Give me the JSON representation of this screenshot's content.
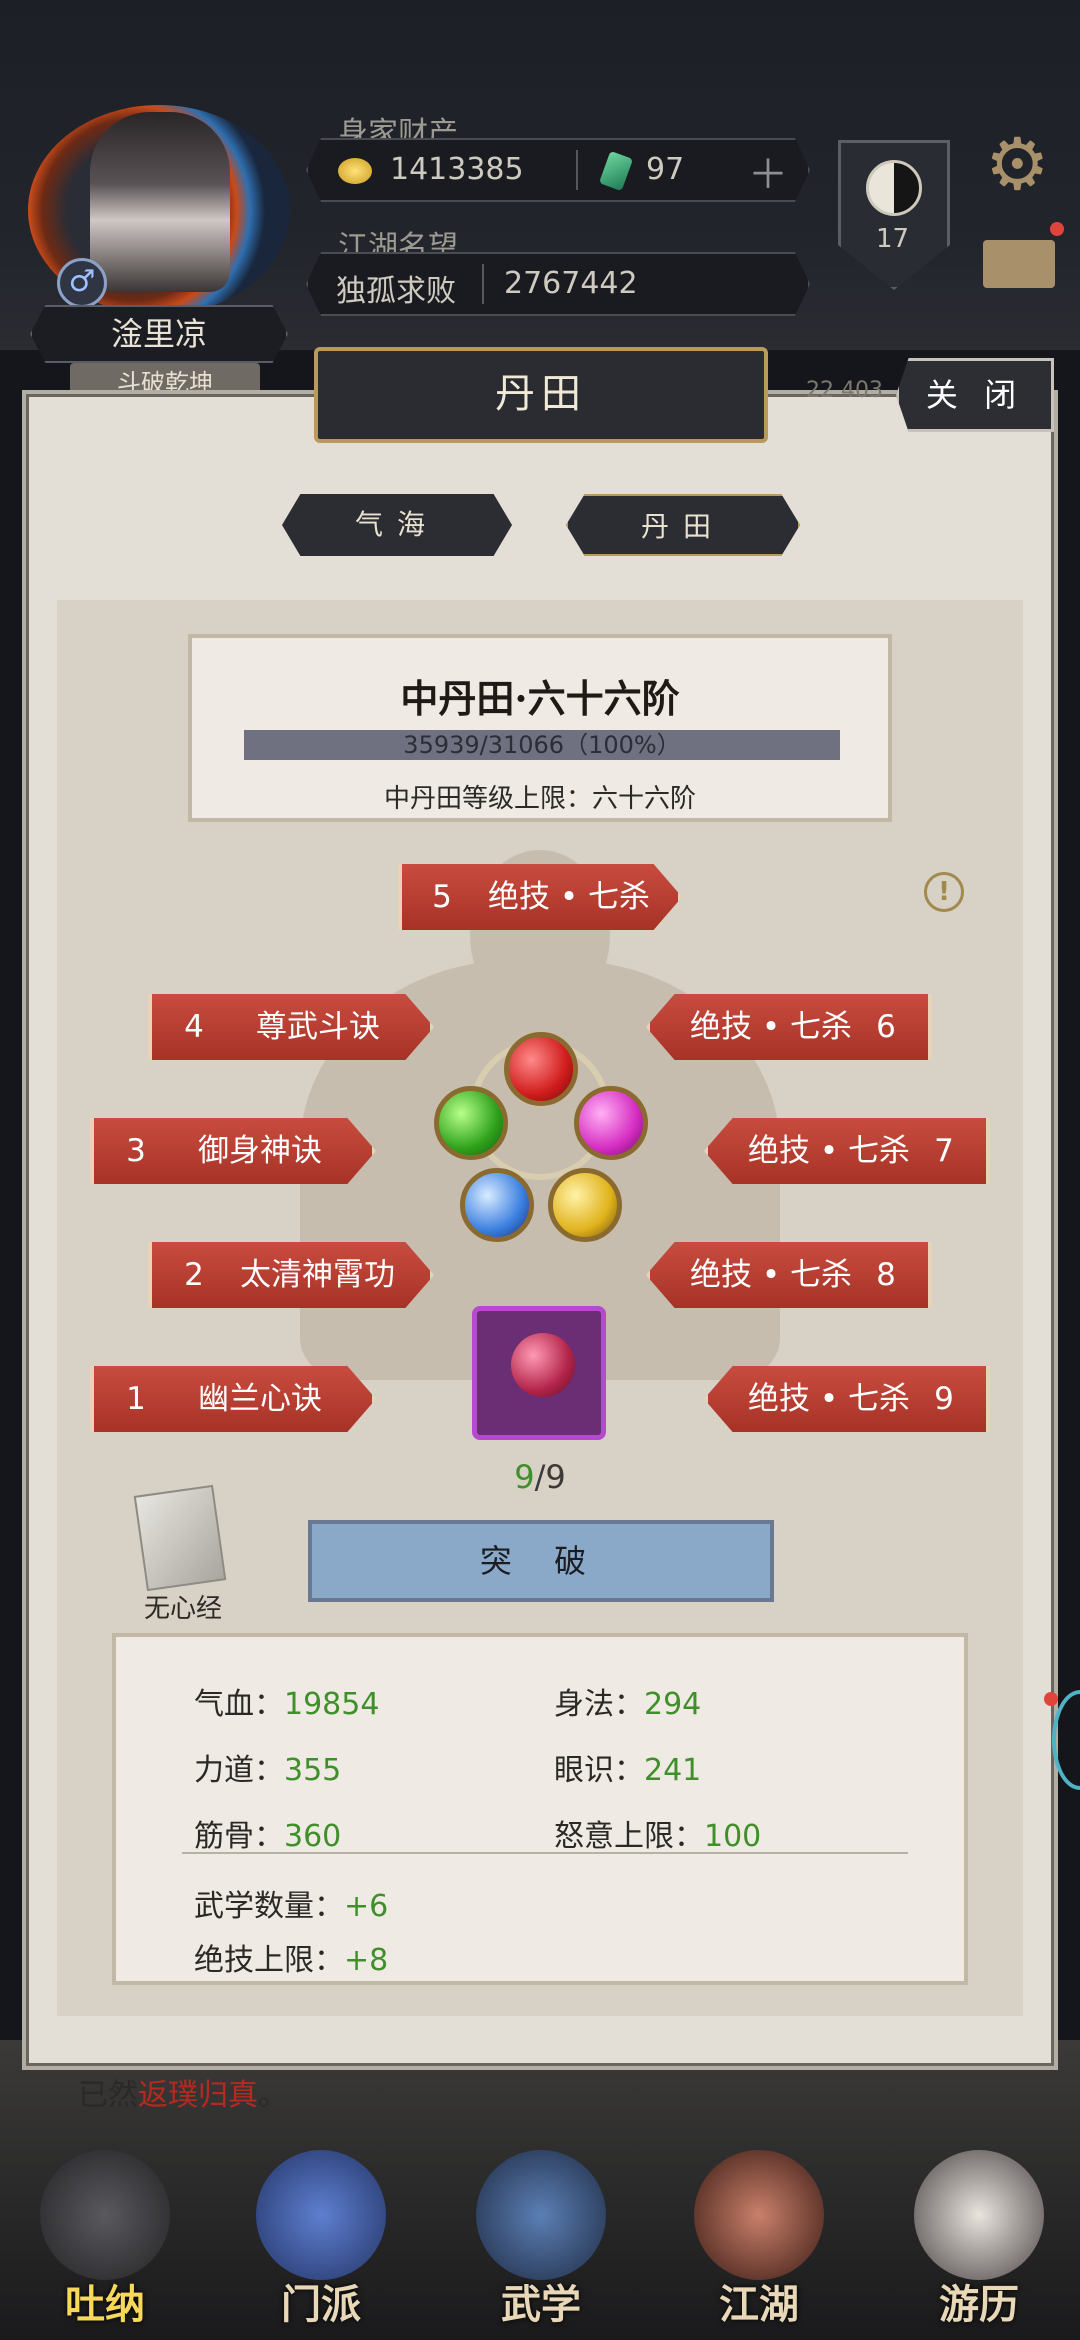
{
  "player": {
    "name": "淦里凉",
    "title_tag": "斗破乾坤"
  },
  "wealth": {
    "label": "身家财产",
    "gold": "1413385",
    "jade": "97"
  },
  "fame": {
    "label": "江湖名望",
    "rank_title": "独孤求败",
    "value": "2767442"
  },
  "level_badge": "17",
  "behind_number": "22 403",
  "panel": {
    "title": "丹田",
    "close_label": "关 闭"
  },
  "tabs": [
    {
      "label": "气海"
    },
    {
      "label": "丹田"
    }
  ],
  "dantian": {
    "title": "中丹田·六十六阶",
    "progress_text": "35939/31066（100%）",
    "progress": 1.0,
    "limit_text": "中丹田等级上限：六十六阶"
  },
  "skills": [
    {
      "num": "1",
      "name": "幽兰心诀"
    },
    {
      "num": "2",
      "name": "太清神霄功"
    },
    {
      "num": "3",
      "name": "御身神诀"
    },
    {
      "num": "4",
      "name": "尊武斗诀"
    },
    {
      "num": "5",
      "name": "绝技 • 七杀"
    },
    {
      "num": "6",
      "name": "绝技 • 七杀"
    },
    {
      "num": "7",
      "name": "绝技 • 七杀"
    },
    {
      "num": "8",
      "name": "绝技 • 七杀"
    },
    {
      "num": "9",
      "name": "绝技 • 七杀"
    }
  ],
  "slot_count": {
    "filled": "9",
    "total": "/9"
  },
  "manual": {
    "label": "无心经"
  },
  "break_button": "突 破",
  "stats": {
    "hp": {
      "label": "气血：",
      "value": "19854"
    },
    "agility": {
      "label": "身法：",
      "value": "294"
    },
    "strength": {
      "label": "力道：",
      "value": "355"
    },
    "insight": {
      "label": "眼识：",
      "value": "241"
    },
    "constitution": {
      "label": "筋骨：",
      "value": "360"
    },
    "rage": {
      "label": "怒意上限：",
      "value": "100"
    },
    "martial_count": {
      "label": "武学数量：",
      "value": "+6"
    },
    "ultimate_limit": {
      "label": "绝技上限：",
      "value": "+8"
    }
  },
  "story": {
    "prefix": "已然",
    "highlight": "返璞归真",
    "suffix": "。"
  },
  "nav": [
    {
      "label": "吐纳",
      "icon": "meditation-icon"
    },
    {
      "label": "门派",
      "icon": "sect-icon"
    },
    {
      "label": "武学",
      "icon": "scroll-icon"
    },
    {
      "label": "江湖",
      "icon": "hat-icon"
    },
    {
      "label": "游历",
      "icon": "horse-icon"
    }
  ]
}
